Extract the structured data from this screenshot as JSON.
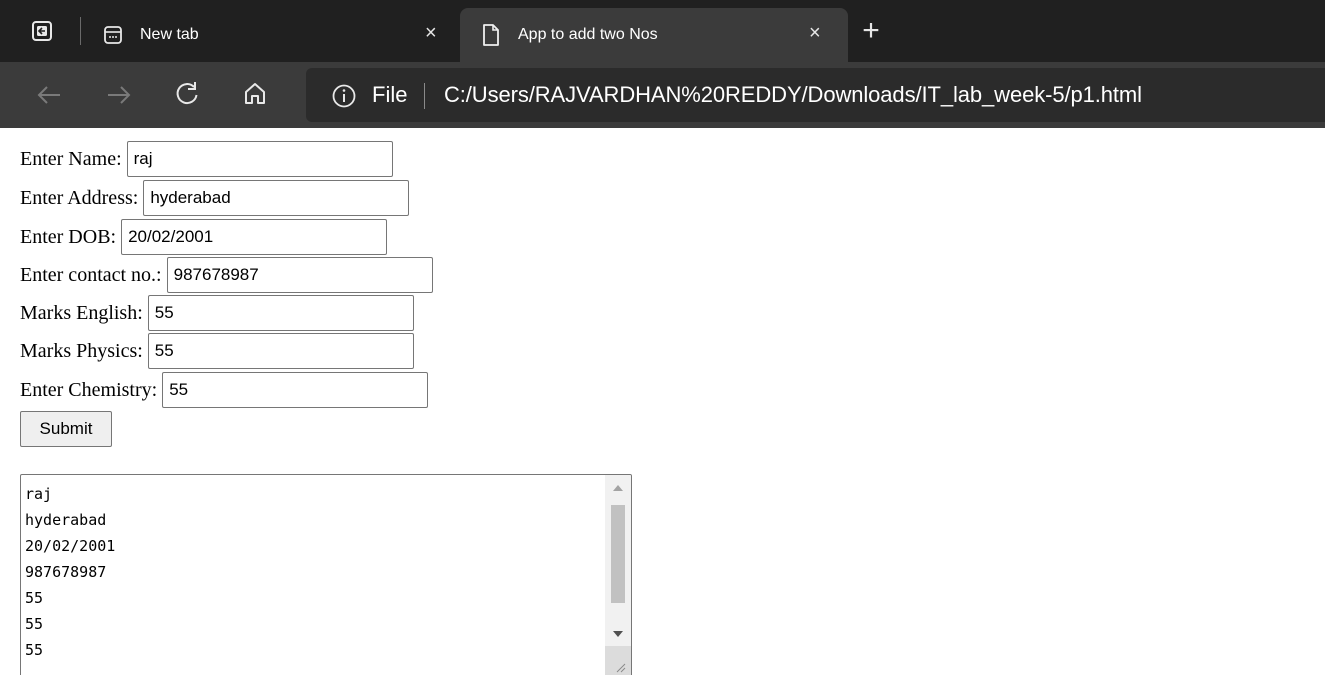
{
  "browser": {
    "tabs": [
      {
        "title": "New tab",
        "close": "×",
        "active": false
      },
      {
        "title": "App to add two Nos",
        "close": "×",
        "active": true
      }
    ],
    "new_tab": "+",
    "address": {
      "site_label": "File",
      "url": "C:/Users/RAJVARDHAN%20REDDY/Downloads/IT_lab_week-5/p1.html"
    },
    "icons": [
      "tab-actions-icon",
      "new-tab-page-icon",
      "page-icon",
      "back-icon",
      "forward-icon",
      "refresh-icon",
      "home-icon",
      "info-icon"
    ]
  },
  "form": {
    "fields": [
      {
        "label": "Enter Name:",
        "value": "raj"
      },
      {
        "label": "Enter Address:",
        "value": "hyderabad"
      },
      {
        "label": "Enter DOB:",
        "value": "20/02/2001"
      },
      {
        "label": "Enter contact no.:",
        "value": "987678987"
      },
      {
        "label": "Marks English:",
        "value": "55"
      },
      {
        "label": "Marks Physics:",
        "value": "55"
      },
      {
        "label": "Enter Chemistry:",
        "value": "55"
      }
    ],
    "submit_label": "Submit"
  },
  "output": {
    "lines": [
      "raj",
      "hyderabad",
      "20/02/2001",
      "987678987",
      "55",
      "55",
      "55"
    ]
  }
}
